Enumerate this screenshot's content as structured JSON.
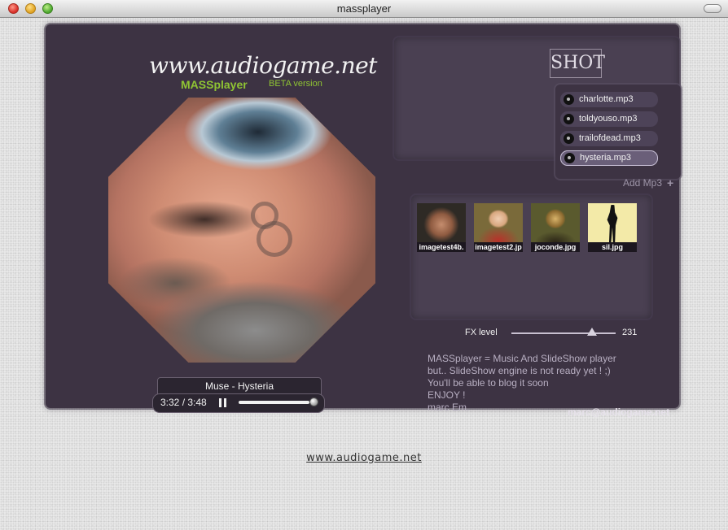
{
  "window": {
    "title": "massplayer"
  },
  "header": {
    "logo_text": "www.audiogame.net",
    "brand": "MASSplayer",
    "beta": "BETA version"
  },
  "player": {
    "track_title": "Muse - Hysteria",
    "time": "3:32 / 3:48",
    "progress": 0.93
  },
  "shot": {
    "label": "SHOT"
  },
  "playlist": {
    "items": [
      {
        "label": "charlotte.mp3"
      },
      {
        "label": "toldyouso.mp3"
      },
      {
        "label": "trailofdead.mp3"
      },
      {
        "label": "hysteria.mp3",
        "active": true
      }
    ],
    "add_label": "Add Mp3",
    "add_icon": "+"
  },
  "images": {
    "items": [
      {
        "caption": "imagetest4b."
      },
      {
        "caption": "imagetest2.jp"
      },
      {
        "caption": "joconde.jpg"
      },
      {
        "caption": "sil.jpg"
      }
    ]
  },
  "fx": {
    "label": "FX level",
    "value": "231"
  },
  "info": {
    "lines": [
      "MASSplayer = Music And SlideShow player",
      "but.. SlideShow engine is not ready yet  ! ;)",
      "You'll be able to blog it soon",
      "ENJOY !",
      "marc Em."
    ],
    "contact": "marc@audiogame.net"
  },
  "footer": {
    "link": "www.audiogame.net"
  },
  "colors": {
    "panel": "#3d3343",
    "accent_green": "#8fc433",
    "text_muted": "#b8afc2"
  }
}
